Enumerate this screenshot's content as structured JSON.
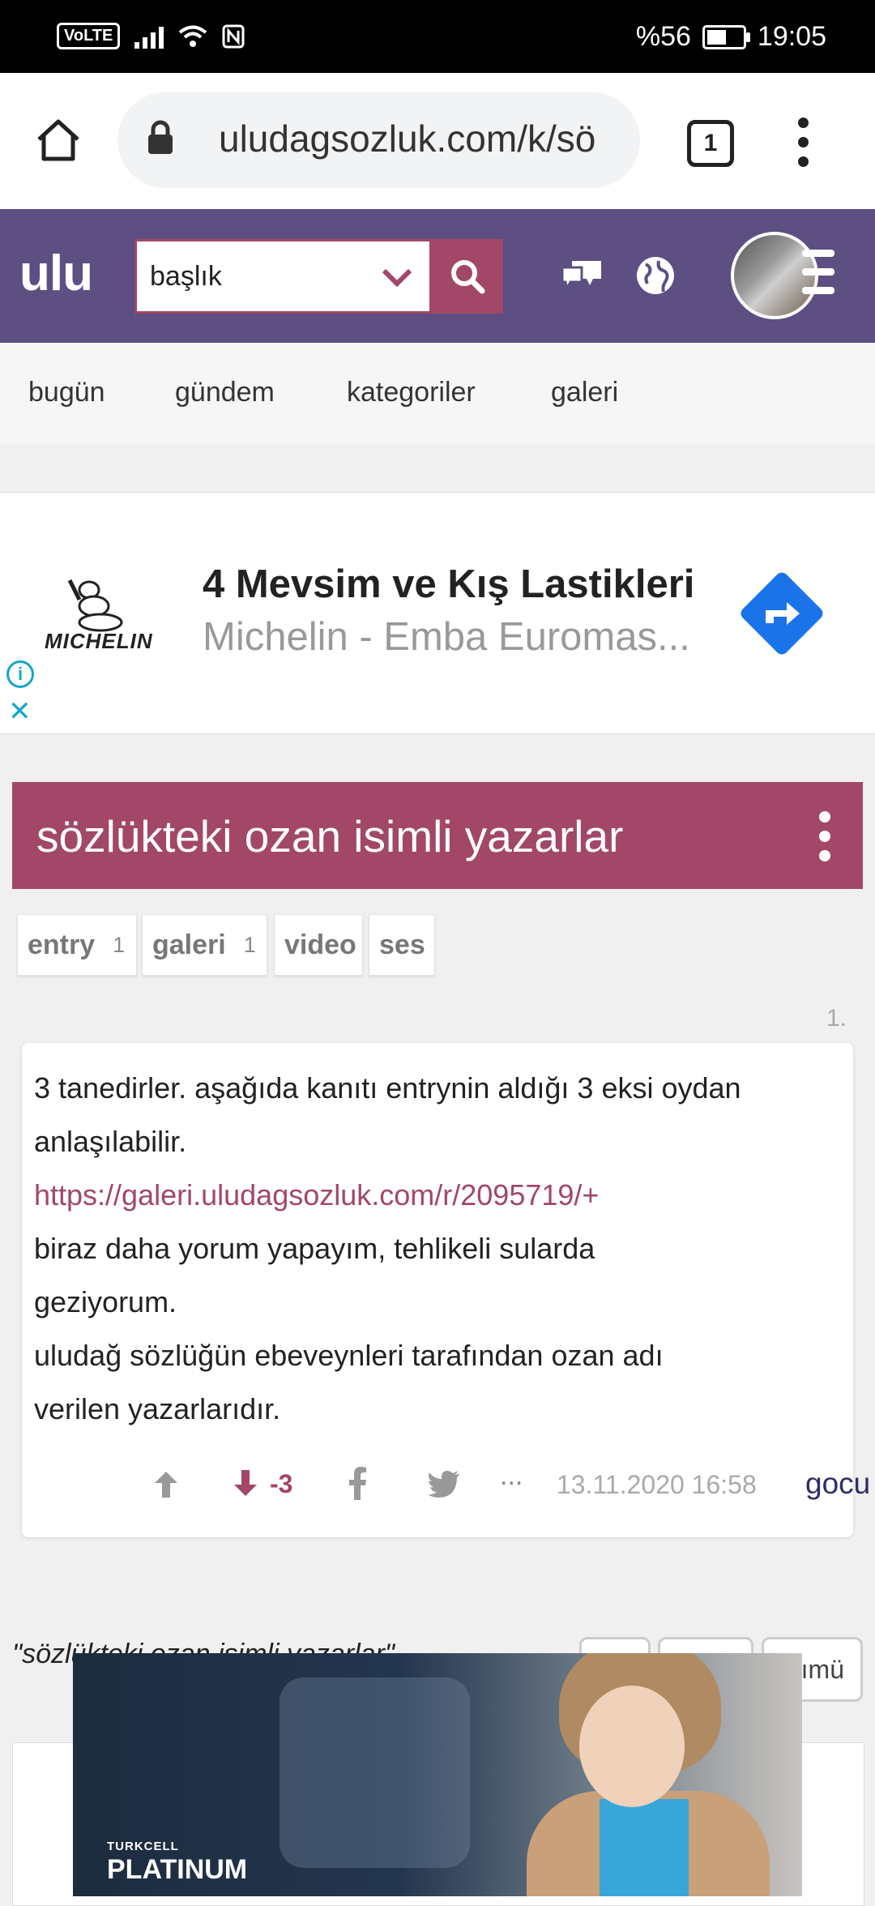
{
  "status_bar": {
    "network": "VoLTE",
    "battery": "%56",
    "battery_level": 0.56,
    "time": "19:05"
  },
  "browser": {
    "url": "uludagsozluk.com/k/sö",
    "tab_count": "1"
  },
  "header": {
    "logo": "ulu",
    "search_value": "başlık"
  },
  "nav": {
    "items": [
      "bugün",
      "gündem",
      "kategoriler",
      "galeri"
    ]
  },
  "ad": {
    "title": "4 Mevsim ve Kış Lastikleri",
    "subtitle": "Michelin - Emba Euromas...",
    "brand": "MICHELIN"
  },
  "topic": {
    "title": "sözlükteki ozan isimli yazarlar"
  },
  "filters": [
    {
      "label": "entry",
      "count": "1"
    },
    {
      "label": "galeri",
      "count": "1"
    },
    {
      "label": "video",
      "count": ""
    },
    {
      "label": "ses",
      "count": ""
    }
  ],
  "entry": {
    "number": "1.",
    "lines": [
      "3 tanedirler. aşağıda kanıtı entrynin aldığı 3 eksi oydan",
      "anlaşılabilir.",
      "https://galeri.uludagsozluk.com/r/2095719/+",
      "biraz daha yorum yapayım, tehlikeli sularda",
      "geziyorum.",
      "uludağ sözlüğün ebeveynleri tarafından ozan adı",
      "verilen yazarlarıdır."
    ],
    "votes": "-3",
    "more": "...",
    "date": "13.11.2020 16:58",
    "author": "gocu"
  },
  "footer": {
    "quote": "\"sözlükteki ozan isimli yazarlar\"",
    "button_partial": "ımü"
  },
  "video_ad": {
    "brand_small": "TURKCELL",
    "brand": "PLATINUM"
  }
}
